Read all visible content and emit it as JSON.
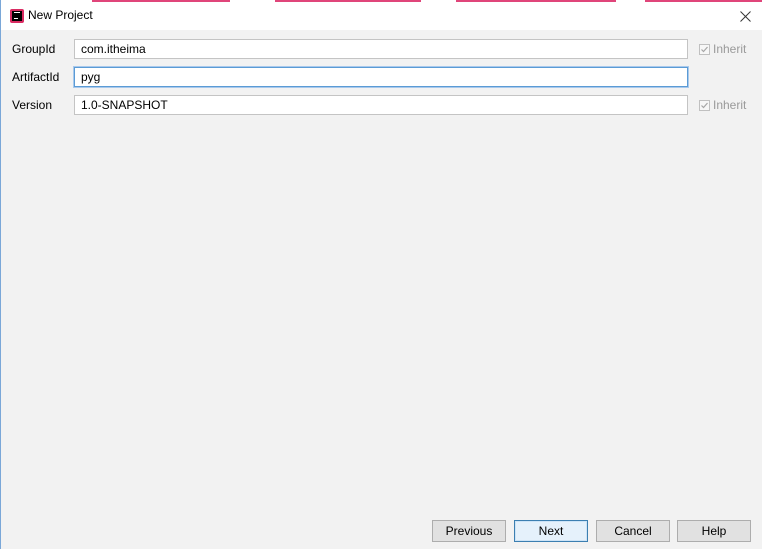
{
  "window": {
    "title": "New Project",
    "close_symbol": "×"
  },
  "icons": {
    "app": "intellij-idea-icon",
    "close": "close-icon",
    "check": "checkmark-icon"
  },
  "colors": {
    "accent_pink": "#d92b62",
    "focus_blue": "#5b9bd5",
    "default_button_border": "#3c7fb1"
  },
  "form": {
    "fields": [
      {
        "label": "GroupId",
        "value": "com.itheima",
        "inherit_label": "Inherit",
        "inherit_checked": true,
        "has_inherit": true
      },
      {
        "label": "ArtifactId",
        "value": "pyg",
        "has_inherit": false,
        "focused": true
      },
      {
        "label": "Version",
        "value": "1.0-SNAPSHOT",
        "inherit_label": "Inherit",
        "inherit_checked": true,
        "has_inherit": true
      }
    ]
  },
  "buttons": {
    "previous": "Previous",
    "next": "Next",
    "cancel": "Cancel",
    "help": "Help"
  }
}
